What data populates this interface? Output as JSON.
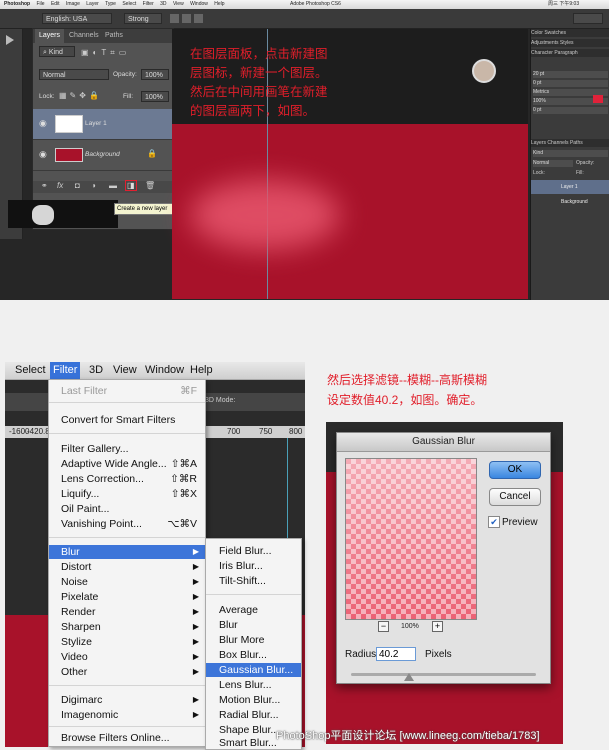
{
  "top": {
    "mac_menu": [
      "Photoshop",
      "File",
      "Edit",
      "Image",
      "Layer",
      "Type",
      "Select",
      "Filter",
      "3D",
      "View",
      "Window",
      "Help"
    ],
    "window_title": "Adobe Photoshop CS6",
    "mac_status": "周三 下午9:03",
    "options": {
      "lang": "English: USA",
      "aa": "Strong"
    },
    "layers_panel": {
      "tabs": [
        "Layers",
        "Channels",
        "Paths"
      ],
      "kind": "Kind",
      "blend_mode": "Normal",
      "opacity_label": "Opacity:",
      "opacity_value": "100%",
      "lock_label": "Lock:",
      "fill_label": "Fill:",
      "fill_value": "100%",
      "layers": [
        {
          "name": "Layer 1",
          "selected": true
        },
        {
          "name": "Background",
          "selected": false
        }
      ],
      "footer_fx": "fx"
    },
    "tooltip": "Create a new layer",
    "note": "在图层面板，点击新建图\n层图标，新建一个图层。\n然后在中间用画笔在新建\n的图层画两下，如图。",
    "right_panel": {
      "tabs1": [
        "Color",
        "Swatches"
      ],
      "tabs2": [
        "Adjustments",
        "Styles"
      ],
      "tabs3": [
        "Character",
        "Paragraph"
      ],
      "lock": "Lock:",
      "fill": "Fill:",
      "kind": "Kind",
      "blend": "Normal",
      "opacity": "Opacity:",
      "layer1": "Layer 1",
      "bg": "Background",
      "layers_tabs": [
        "Layers",
        "Channels",
        "Paths"
      ],
      "size_fields": [
        "20 pt",
        "0 pt",
        "Metrics",
        "100%",
        "0 pt"
      ]
    }
  },
  "bottom": {
    "menubar": [
      "Select",
      "Filter",
      "3D",
      "View",
      "Window",
      "Help"
    ],
    "ruler": [
      "-1600",
      "-420.8",
      "700",
      "750",
      "800"
    ],
    "mode_label": "3D Mode:",
    "filter_menu": {
      "last_filter": "Last Filter",
      "last_filter_key": "⌘F",
      "smart": "Convert for Smart Filters",
      "items1": [
        {
          "t": "Filter Gallery...",
          "k": ""
        },
        {
          "t": "Adaptive Wide Angle...",
          "k": "⇧⌘A"
        },
        {
          "t": "Lens Correction...",
          "k": "⇧⌘R"
        },
        {
          "t": "Liquify...",
          "k": "⇧⌘X"
        },
        {
          "t": "Oil Paint...",
          "k": ""
        },
        {
          "t": "Vanishing Point...",
          "k": "⌥⌘V"
        }
      ],
      "submenus": [
        "Blur",
        "Distort",
        "Noise",
        "Pixelate",
        "Render",
        "Sharpen",
        "Stylize",
        "Video",
        "Other"
      ],
      "submenus2": [
        "Digimarc",
        "Imagenomic"
      ],
      "browse": "Browse Filters Online..."
    },
    "blur_submenu": {
      "group1": [
        "Field Blur...",
        "Iris Blur...",
        "Tilt-Shift..."
      ],
      "group2": [
        "Average",
        "Blur",
        "Blur More",
        "Box Blur...",
        "Gaussian Blur...",
        "Lens Blur...",
        "Motion Blur...",
        "Radial Blur...",
        "Shape Blur...",
        "Smart Blur..."
      ]
    },
    "note": "然后选择滤镜--模糊--高斯模糊\n设定数值40.2，如图。确定。",
    "dialog": {
      "title": "Gaussian Blur",
      "ok": "OK",
      "cancel": "Cancel",
      "preview": "Preview",
      "zoom": "100%",
      "minus": "−",
      "plus": "+",
      "radius_label": "Radius:",
      "radius_value": "40.2",
      "radius_unit": "Pixels"
    },
    "watermark": "PhotoShop平面设计论坛 [www.lineeg.com/tieba/1783]"
  }
}
